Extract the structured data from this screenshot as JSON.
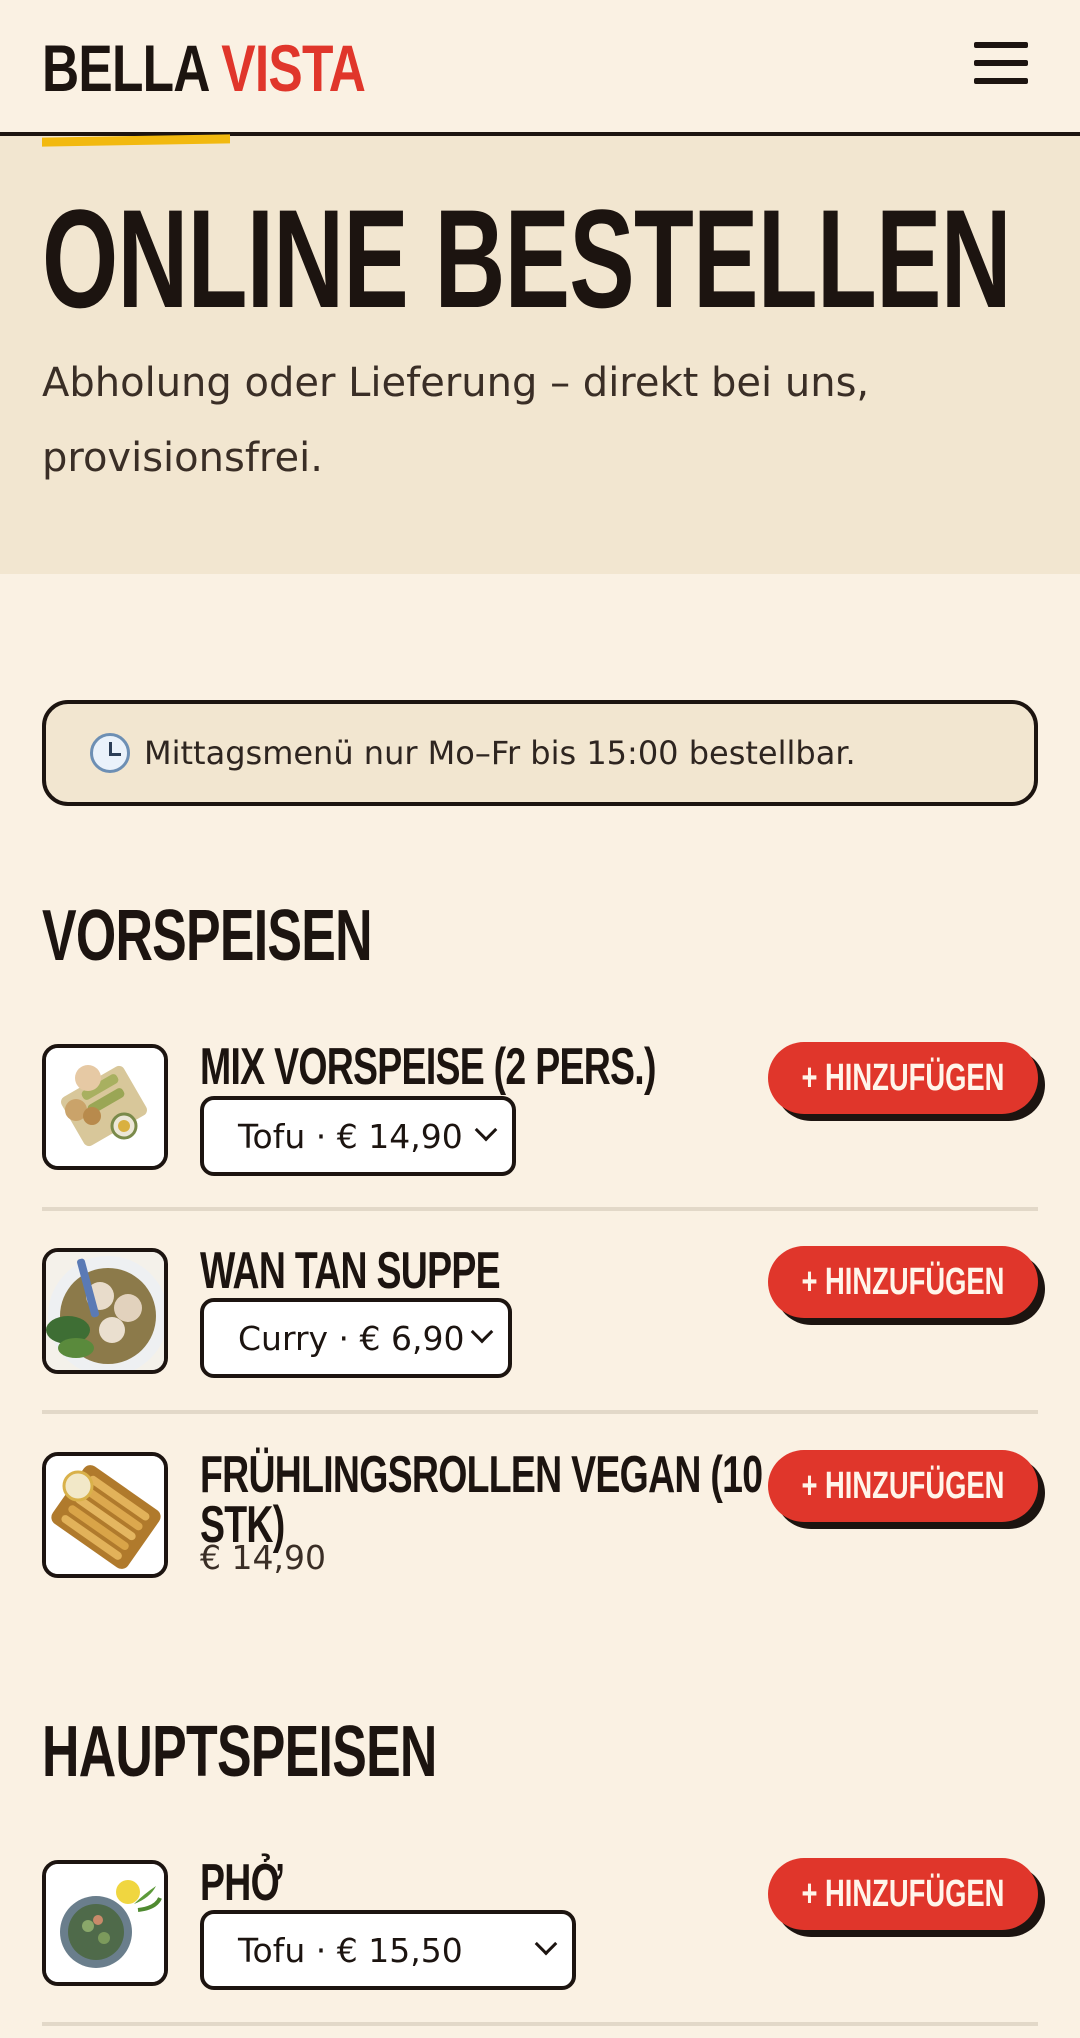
{
  "header": {
    "logo_part1": "BELLA",
    "logo_part2": "VISTA",
    "menu_icon": "hamburger-icon"
  },
  "hero": {
    "title": "ONLINE BESTELLEN",
    "subtitle": "Abholung oder Lieferung – direkt bei uns, provisionsfrei."
  },
  "notice": {
    "icon": "clock-icon",
    "text": "Mittagsmenü nur Mo–Fr bis 15:00 bestellbar."
  },
  "sections": [
    {
      "title": "VORSPEISEN",
      "items": [
        {
          "name": "MIX VORSPEISE (2 PERS.)",
          "selected_option": "Tofu · € 14,90",
          "button": "+ HINZUFÜGEN"
        },
        {
          "name": "WAN TAN SUPPE",
          "selected_option": "Curry · € 6,90",
          "button": "+ HINZUFÜGEN"
        },
        {
          "name": "FRÜHLINGSROLLEN VEGAN (10 STK)",
          "price": "€ 14,90",
          "button": "+ HINZUFÜGEN"
        }
      ]
    },
    {
      "title": "HAUPTSPEISEN",
      "items": [
        {
          "name": "PHỞ",
          "selected_option": "Tofu · € 15,50",
          "button": "+ HINZUFÜGEN"
        }
      ]
    }
  ],
  "colors": {
    "background": "#faf1e3",
    "hero_bg": "#f2e6d0",
    "accent_red": "#e0362b",
    "accent_yellow": "#f2b90f",
    "ink": "#1c1410"
  }
}
